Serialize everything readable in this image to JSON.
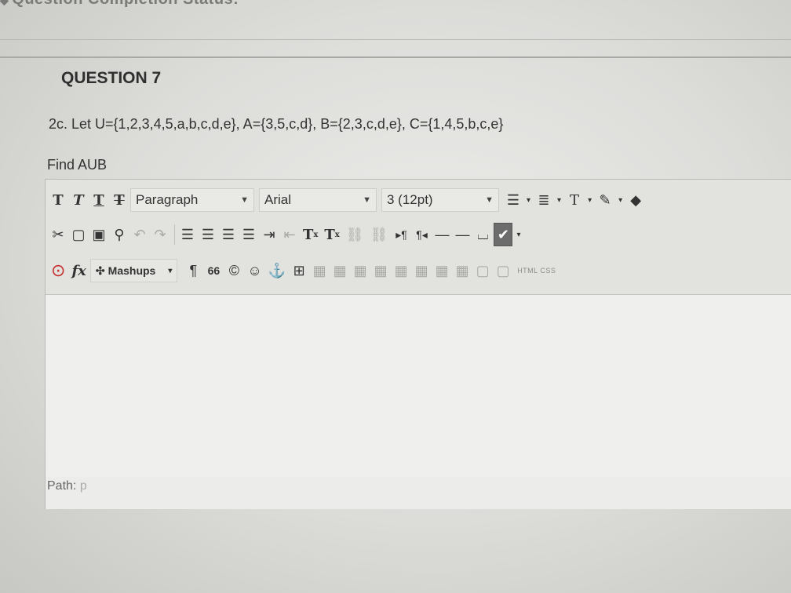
{
  "top_status": "Question Completion Status:",
  "question": {
    "heading": "QUESTION 7",
    "text": "2c. Let U={1,2,3,4,5,a,b,c,d,e}, A={3,5,c,d}, B={2,3,c,d,e}, C={1,4,5,b,c,e}",
    "prompt": "Find AUB"
  },
  "toolbar": {
    "row1": {
      "format_buttons": [
        "T",
        "T",
        "T",
        "T"
      ],
      "paragraph": "Paragraph",
      "font": "Arial",
      "size": "3 (12pt)"
    },
    "row2": {
      "superscript": "T",
      "subscript": "T"
    },
    "row3": {
      "fx": "fx",
      "mashups": "Mashups",
      "pilcrow": "¶",
      "quote": "66",
      "copyright": "©",
      "html_css": "HTML CSS"
    }
  },
  "path": {
    "label": "Path:",
    "value": "p"
  }
}
